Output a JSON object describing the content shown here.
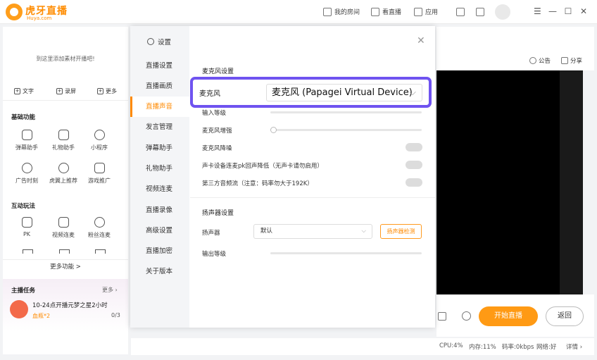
{
  "brand": {
    "name": "虎牙直播",
    "sub": "Huya.com"
  },
  "topbar": {
    "my_room": "我的房间",
    "watch": "看直播",
    "apps": "应用",
    "minimize": "—",
    "close": "✕"
  },
  "left": {
    "empty_hint": "到这里添加素材开播吧!",
    "add_text": "文字",
    "add_screen": "录屏",
    "add_more": "更多",
    "basic_title": "基础功能",
    "basic": [
      "弹幕助手",
      "礼物助手",
      "小程序",
      "广告时刻",
      "虎翼上推荐",
      "游戏推广"
    ],
    "interactive_title": "互动玩法",
    "interactive": [
      "PK",
      "视频连麦",
      "粉丝连麦"
    ],
    "more_func": "更多功能 >",
    "task_title": "主播任务",
    "task_more": "更多",
    "task_desc": "10-24点开播元梦之星2小时",
    "task_reward": "血瓶*2",
    "task_progress": "0/3"
  },
  "dialog": {
    "title": "设置",
    "close": "✕",
    "nav": [
      "直播设置",
      "直播画质",
      "直播声音",
      "发言管理",
      "弹幕助手",
      "礼物助手",
      "视频连麦",
      "直播录像",
      "高级设置",
      "直播加密",
      "关于版本"
    ],
    "mic_section": "麦克风设置",
    "mic_label": "麦克风",
    "mic_value": "麦克风 (Papagei Virtual Device)",
    "input_level": "输入等级",
    "mic_boost": "麦克风增强",
    "mic_denoise": "麦克风降噪",
    "pk_reduce": "声卡设备连麦pk回声降低（无声卡请勿启用）",
    "third_party": "第三方音频流（注意：码率勿大于192K）",
    "speaker_section": "扬声器设置",
    "speaker_label": "扬声器",
    "speaker_value": "默认",
    "speaker_test": "扬声器检测",
    "output_level": "输出等级"
  },
  "right": {
    "notice": "公告",
    "share": "分享",
    "start": "开始直播",
    "back": "返回"
  },
  "status": {
    "cpu": "CPU:4%",
    "mem": "内存:11%",
    "bitrate": "码率:0kbps",
    "network": "网络:好",
    "detail": "详情 ›"
  },
  "colors": {
    "accent": "#ff9a14",
    "highlight": "#6f53f0"
  }
}
